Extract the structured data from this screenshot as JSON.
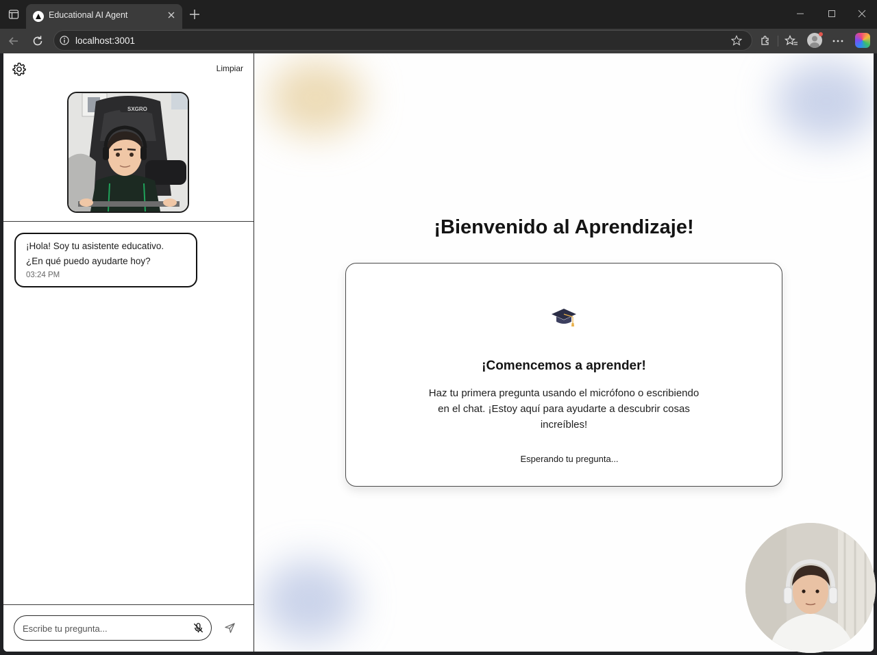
{
  "browser": {
    "tab_title": "Educational AI Agent",
    "url": "localhost:3001"
  },
  "sidebar": {
    "clear_label": "Limpiar",
    "messages": [
      {
        "lines": [
          "¡Hola! Soy tu asistente educativo.",
          "¿En qué puedo ayudarte hoy?"
        ],
        "time": "03:24 PM"
      }
    ],
    "input_placeholder": "Escribe tu pregunta..."
  },
  "main": {
    "title": "¡Bienvenido al Aprendizaje!",
    "card": {
      "icon": "graduation-cap-icon",
      "title": "¡Comencemos a aprender!",
      "body": "Haz tu primera pregunta usando el micrófono o escribiendo en el chat. ¡Estoy aquí para ayudarte a descubrir cosas increíbles!",
      "status": "Esperando tu pregunta..."
    }
  },
  "colors": {
    "chrome_dark": "#202020",
    "chrome_toolbar": "#3b3b3b",
    "border": "#1c1c1c",
    "text": "#141414"
  }
}
